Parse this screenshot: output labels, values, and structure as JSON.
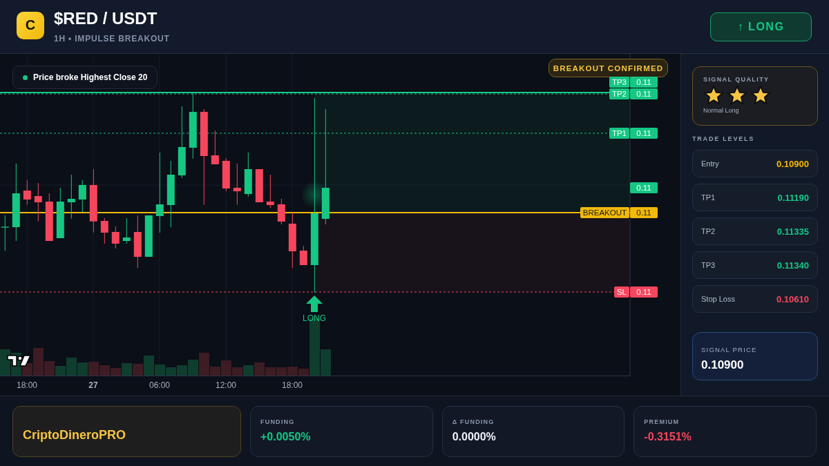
{
  "header": {
    "logo": "C",
    "title": "$RED / USDT",
    "subtitle": "1H • IMPULSE BREAKOUT",
    "action_button": "↑ LONG"
  },
  "chart": {
    "alert": "Price broke Highest Close 20",
    "status_badge": "BREAKOUT CONFIRMED",
    "price_tags": [
      {
        "name": "TP3",
        "value": "0.11",
        "kind": "target"
      },
      {
        "name": "TP2",
        "value": "0.11",
        "kind": "target"
      },
      {
        "name": "TP1",
        "value": "0.11",
        "kind": "target"
      },
      {
        "value": "0.11",
        "kind": "current"
      },
      {
        "name": "BREAKOUT",
        "value": "0.11",
        "kind": "breakout"
      },
      {
        "name": "SL",
        "value": "0.11",
        "kind": "stop"
      }
    ],
    "signal_marker": "LONG",
    "time_axis": [
      "18:00",
      "27",
      "06:00",
      "12:00",
      "18:00"
    ]
  },
  "signal_quality": {
    "title": "SIGNAL QUALITY",
    "stars": 3,
    "label": "Normal Long"
  },
  "trade_levels": {
    "title": "TRADE LEVELS",
    "rows": [
      {
        "label": "Entry",
        "value": "0.10900",
        "kind": "entry"
      },
      {
        "label": "TP1",
        "value": "0.11190",
        "kind": "target"
      },
      {
        "label": "TP2",
        "value": "0.11335",
        "kind": "target"
      },
      {
        "label": "TP3",
        "value": "0.11340",
        "kind": "target"
      },
      {
        "label": "Stop Loss",
        "value": "0.10610",
        "kind": "stop"
      }
    ]
  },
  "signal_price": {
    "title": "SIGNAL PRICE",
    "value": "0.10900"
  },
  "footer": {
    "brand": "CriptoDineroPRO",
    "stats": [
      {
        "label": "FUNDING",
        "value": "+0.0050%",
        "kind": "positive"
      },
      {
        "label": "Δ FUNDING",
        "value": "0.0000%",
        "kind": "neutral"
      },
      {
        "label": "PREMIUM",
        "value": "-0.3151%",
        "kind": "negative"
      }
    ]
  }
}
